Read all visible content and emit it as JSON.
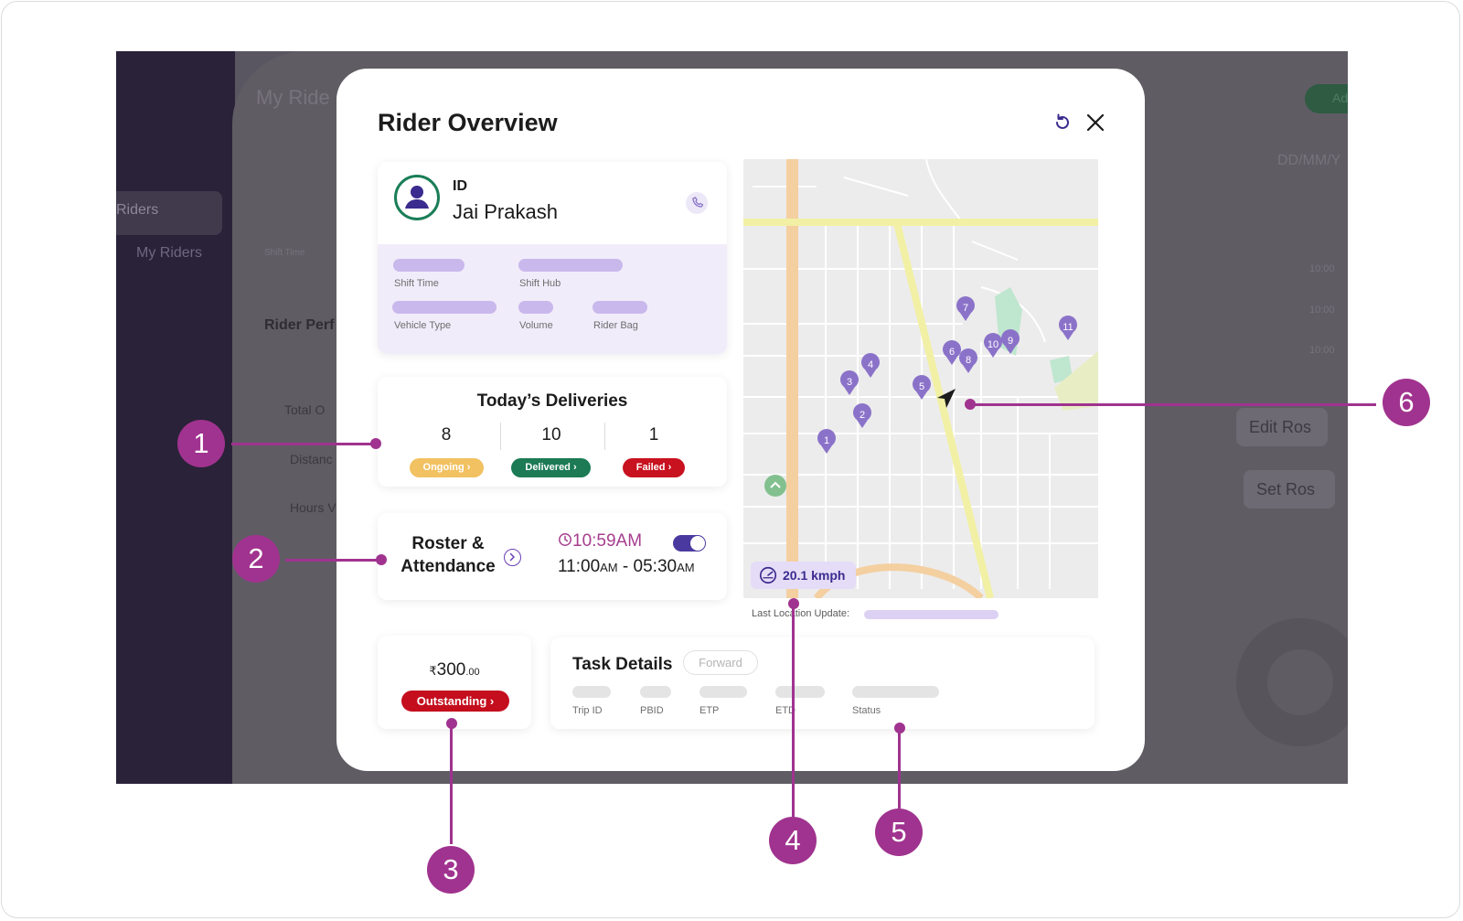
{
  "background": {
    "page_title": "My Ride",
    "sidebar_section": "Riders",
    "sidebar_item": "My Riders",
    "shift_time": "Shift Time",
    "rider_performance": "Rider Perf",
    "total": "Total O",
    "distance": "Distanc",
    "hours": "Hours V",
    "date_filter": "DD/MM/Y",
    "edit_roster": "Edit Ros",
    "set_roster": "Set Ros",
    "add_button": "Ad",
    "rows": [
      "10:00",
      "10:00",
      "10:00"
    ]
  },
  "modal": {
    "title": "Rider Overview",
    "rider": {
      "id_label": "ID",
      "name": "Jai Prakash",
      "fields": [
        "Shift Time",
        "Shift Hub",
        "Vehicle Type",
        "Volume",
        "Rider Bag"
      ]
    },
    "deliveries": {
      "title": "Today’s Deliveries",
      "stats": [
        {
          "count": "8",
          "label": "Ongoing ›",
          "color": "#f2c162"
        },
        {
          "count": "10",
          "label": "Delivered ›",
          "color": "#1c7a55"
        },
        {
          "count": "1",
          "label": "Failed ›",
          "color": "#c8121f"
        }
      ]
    },
    "roster": {
      "label_line1": "Roster &",
      "label_line2": "Attendance",
      "current_time": "10:59AM",
      "shift_start": "11:00",
      "shift_start_suffix": "AM",
      "separator": " - ",
      "shift_end": "05:30",
      "shift_end_suffix": "AM"
    },
    "outstanding": {
      "currency": "₹",
      "amount": "300",
      "decimals": ".00",
      "label": "Outstanding ›"
    },
    "tasks": {
      "title": "Task Details",
      "forward_label": "Forward",
      "columns": [
        "Trip ID",
        "PBID",
        "ETP",
        "ETD",
        "Status"
      ]
    },
    "map": {
      "speed": "20.1 kmph",
      "location_label": "Last Location Update:",
      "markers": [
        "1",
        "2",
        "3",
        "4",
        "5",
        "6",
        "7",
        "8",
        "9",
        "10",
        "11"
      ]
    }
  },
  "callouts": [
    "1",
    "2",
    "3",
    "4",
    "5",
    "6"
  ],
  "colors": {
    "accent": "#a0338f",
    "brand_purple": "#4a3aa0",
    "marker": "#8b72c9"
  }
}
